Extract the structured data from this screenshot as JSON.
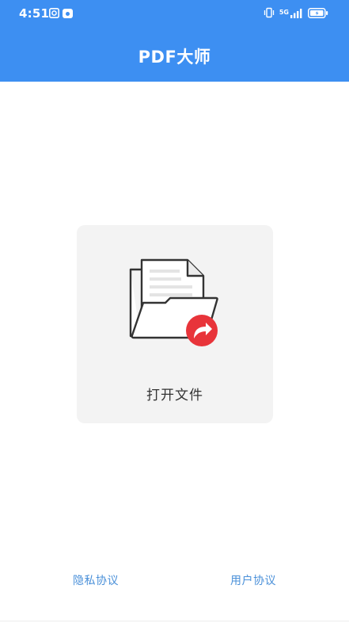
{
  "status_bar": {
    "time": "4:51",
    "network_label": "5G"
  },
  "header": {
    "title": "PDF大师",
    "background": "#3d8ff2"
  },
  "main": {
    "open_file_label": "打开文件",
    "icons": {
      "folder": "folder-document-icon",
      "share": "share-arrow-icon"
    },
    "accent_color": "#e8343a"
  },
  "footer": {
    "privacy_label": "隐私协议",
    "user_label": "用户协议",
    "link_color": "#4a90d9"
  }
}
